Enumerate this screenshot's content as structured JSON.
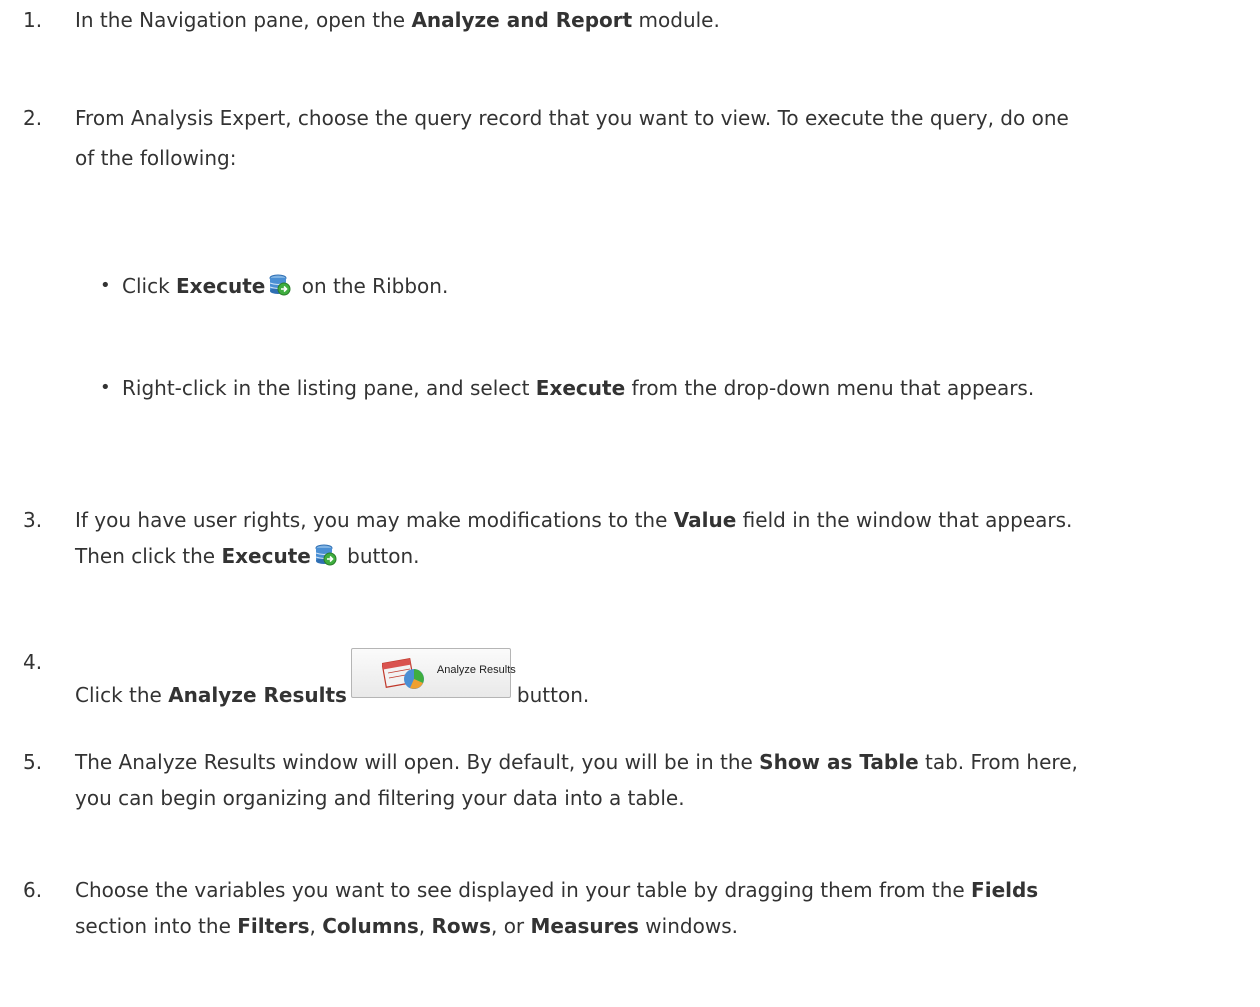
{
  "steps": [
    {
      "num": "1.",
      "pre": "In the Navigation pane, open the ",
      "bold": "Analyze and Report",
      "post": " module."
    },
    {
      "num": "2.",
      "line1": "From Analysis Expert, choose the query record that you want to view. To execute the query, do one",
      "line2": "of the following:"
    },
    {
      "num": "3.",
      "l1_pre": "If you have user rights, you may make modifications to the ",
      "l1_bold": "Value",
      "l1_post": " field in the window that appears.",
      "l2_pre": "Then click the ",
      "l2_bold": "Execute",
      "l2_post": " button."
    },
    {
      "num": "4.",
      "pre": "Click the ",
      "bold": "Analyze Results",
      "button_label": "Analyze Results",
      "post": "button."
    },
    {
      "num": "5.",
      "l1_pre": "The Analyze Results window will open. By default, you will be in the ",
      "l1_bold": "Show as Table",
      "l1_post": " tab. From here,",
      "line2": "you can begin organizing and filtering your data into a table."
    },
    {
      "num": "6.",
      "l1_pre": "Choose the variables you want to see displayed in your table by dragging them from the ",
      "l1_bold": "Fields",
      "l2_pre": "section into the ",
      "b1": "Filters",
      "s1": ", ",
      "b2": "Columns",
      "s2": ", ",
      "b3": "Rows",
      "s3": ", or ",
      "b4": "Measures",
      "l2_post": " windows."
    }
  ],
  "bullets": [
    {
      "symbol": "•",
      "pre": "Click ",
      "bold": "Execute",
      "post": " on the Ribbon."
    },
    {
      "symbol": "•",
      "pre": "Right-click in the listing pane, and select ",
      "bold": "Execute",
      "post": " from the drop-down menu that appears."
    }
  ],
  "icons": {
    "execute": "execute-database-icon",
    "analyze": "analyze-results-icon"
  }
}
